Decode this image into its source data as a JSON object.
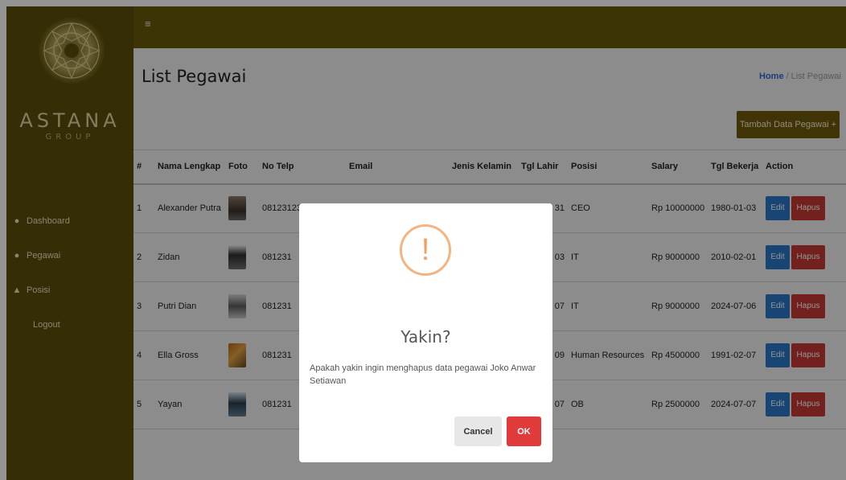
{
  "brand": {
    "name": "ASTANA",
    "sub": "GROUP",
    "accent": "#6a5a0b"
  },
  "sidebar": {
    "items": [
      {
        "label": "Dashboard",
        "icon": "gauge-icon"
      },
      {
        "label": "Pegawai",
        "icon": "users-icon"
      },
      {
        "label": "Posisi",
        "icon": "sitemap-icon"
      },
      {
        "label": "Logout"
      }
    ]
  },
  "page": {
    "title": "List Pegawai"
  },
  "breadcrumb": {
    "home": "Home",
    "separator": "/",
    "current": "List Pegawai"
  },
  "add_button": "Tambah Data Pegawai +",
  "table": {
    "headers": [
      "#",
      "Nama Lengkap",
      "Foto",
      "No Telp",
      "Email",
      "Jenis Kelamin",
      "Tgl Lahir",
      "Posisi",
      "Salary",
      "Tgl Bekerja",
      "Action"
    ],
    "rows": [
      {
        "no": "1",
        "name": "Alexander Putra",
        "phone": "081231231231",
        "email": "",
        "gender": "",
        "birth": "31",
        "position": "CEO",
        "salary": "Rp 10000000",
        "joined": "1980-01-03"
      },
      {
        "no": "2",
        "name": "Zidan",
        "phone": "081231",
        "email": "",
        "gender": "",
        "birth": "03",
        "position": "IT",
        "salary": "Rp 9000000",
        "joined": "2010-02-01"
      },
      {
        "no": "3",
        "name": "Putri Dian",
        "phone": "081231",
        "email": "",
        "gender": "",
        "birth": "07",
        "position": "IT",
        "salary": "Rp 9000000",
        "joined": "2024-07-06"
      },
      {
        "no": "4",
        "name": "Ella Gross",
        "phone": "081231",
        "email": "",
        "gender": "",
        "birth": "09",
        "position": "Human Resources",
        "salary": "Rp 4500000",
        "joined": "1991-02-07"
      },
      {
        "no": "5",
        "name": "Yayan",
        "phone": "081231",
        "email": "",
        "gender": "",
        "birth": "07",
        "position": "OB",
        "salary": "Rp 2500000",
        "joined": "2024-07-07"
      }
    ],
    "edit_label": "Edit",
    "delete_label": "Hapus"
  },
  "dialog": {
    "icon": "warning-icon",
    "icon_glyph": "!",
    "title": "Yakin?",
    "message": "Apakah yakin ingin menghapus data pegawai Joko Anwar Setiawan",
    "cancel_label": "Cancel",
    "ok_label": "OK"
  }
}
